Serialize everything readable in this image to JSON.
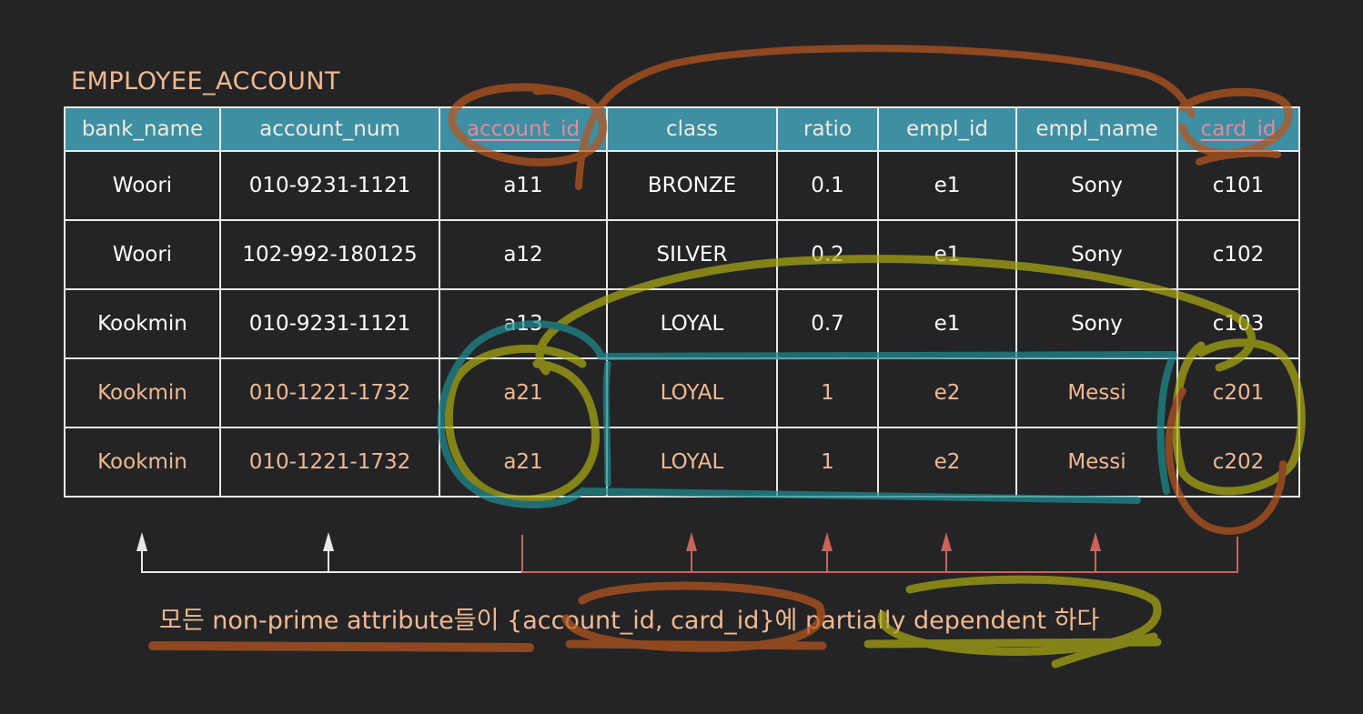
{
  "table": {
    "name": "EMPLOYEE_ACCOUNT",
    "columns": [
      "bank_name",
      "account_num",
      "account_id",
      "class",
      "ratio",
      "empl_id",
      "empl_name",
      "card_id"
    ],
    "key_columns": [
      "account_id",
      "card_id"
    ],
    "rows": [
      [
        "Woori",
        "010-9231-1121",
        "a11",
        "BRONZE",
        "0.1",
        "e1",
        "Sony",
        "c101"
      ],
      [
        "Woori",
        "102-992-180125",
        "a12",
        "SILVER",
        "0.2",
        "e1",
        "Sony",
        "c102"
      ],
      [
        "Kookmin",
        "010-9231-1121",
        "a13",
        "LOYAL",
        "0.7",
        "e1",
        "Sony",
        "c103"
      ],
      [
        "Kookmin",
        "010-1221-1732",
        "a21",
        "LOYAL",
        "1",
        "e2",
        "Messi",
        "c201"
      ],
      [
        "Kookmin",
        "010-1221-1732",
        "a21",
        "LOYAL",
        "1",
        "e2",
        "Messi",
        "c202"
      ]
    ],
    "highlighted_rows": [
      3,
      4
    ]
  },
  "note": "모든 non-prime attribute들이 {account_id, card_id}에 partially dependent 하다",
  "colors": {
    "background": "#242426",
    "header_fill": "#3d8fa3",
    "accent_text": "#f2b990",
    "key_text": "#e58a9b",
    "arrow_white": "#e9e9e9",
    "arrow_red": "#c8645a",
    "ink_brown": "#b8561f",
    "ink_yellow": "#a8a814",
    "ink_teal": "#1e8c90"
  }
}
